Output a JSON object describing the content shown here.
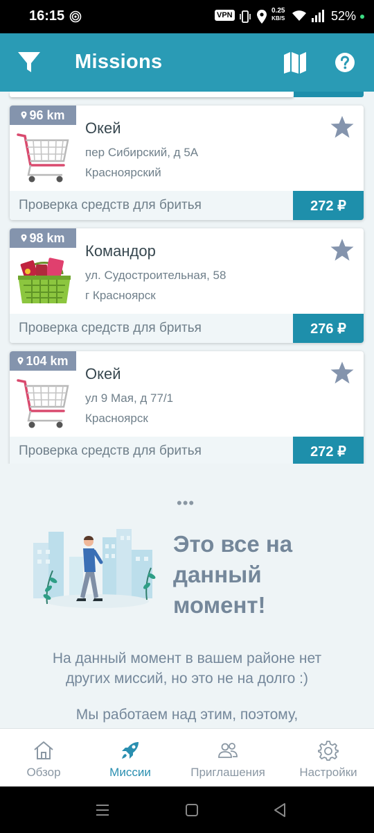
{
  "status_bar": {
    "time": "16:15",
    "vpn": "VPN",
    "net_speed_value": "0.25",
    "net_speed_unit": "KB/S",
    "battery": "52%"
  },
  "app_bar": {
    "title": "Missions",
    "icons": [
      "filter-icon",
      "map-icon",
      "help-icon"
    ]
  },
  "missions": [
    {
      "distance": "96 km",
      "name": "Окей",
      "address": "пер Сибирский, д 5А",
      "city": "Красноярский",
      "task": "Проверка средств для бритья",
      "price": "272 ₽",
      "image": "shopping-cart-icon"
    },
    {
      "distance": "98 km",
      "name": "Командор",
      "address": "ул. Судостроительная, 58",
      "city": "г Красноярск",
      "task": "Проверка средств для бритья",
      "price": "276 ₽",
      "image": "grocery-basket-icon"
    },
    {
      "distance": "104 km",
      "name": "Окей",
      "address": "ул 9 Мая, д 77/1",
      "city": "Красноярск",
      "task": "Проверка средств для бритья",
      "price": "272 ₽",
      "image": "shopping-cart-icon"
    }
  ],
  "end_of_list": {
    "dots": "•••",
    "title_lines": [
      "Это все на",
      "данный",
      "момент!"
    ],
    "text_lines": [
      "На данный момент в вашем районе нет",
      "других миссий, но это не на долго :)"
    ],
    "text2": "Мы работаем над этим, поэтому,"
  },
  "bottom_nav": [
    {
      "label": "Обзор",
      "icon": "home-icon",
      "active": false
    },
    {
      "label": "Миссии",
      "icon": "rocket-icon",
      "active": true
    },
    {
      "label": "Приглашения",
      "icon": "people-icon",
      "active": false
    },
    {
      "label": "Настройки",
      "icon": "gear-icon",
      "active": false
    }
  ],
  "colors": {
    "app_bar": "#2a9bb5",
    "price_badge": "#1e8fab",
    "distance_badge": "#8494ad",
    "nav_active": "#2a8fb0",
    "background": "#eef4f6"
  }
}
